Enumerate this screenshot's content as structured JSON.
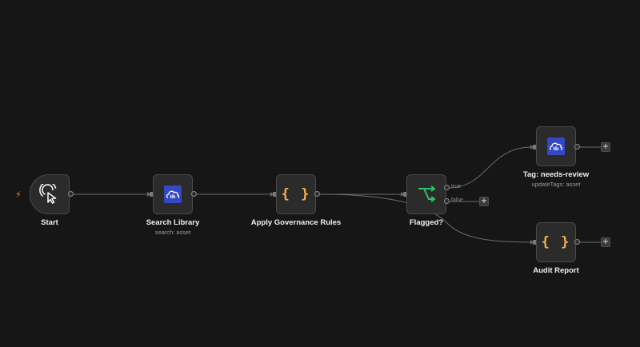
{
  "nodes": {
    "start": {
      "label": "Start",
      "icon": "cursor-click-icon"
    },
    "search_library": {
      "label": "Search Library",
      "sublabel": "search: asset",
      "icon": "cloudinary-icon"
    },
    "apply_rules": {
      "label": "Apply Governance Rules",
      "icon": "code-braces-icon",
      "icon_text": "{ }"
    },
    "flagged": {
      "label": "Flagged?",
      "icon": "branch-if-icon",
      "branches": {
        "true_label": "true",
        "false_label": "false"
      }
    },
    "tag_review": {
      "label": "Tag: needs-review",
      "sublabel": "updateTags: asset",
      "icon": "cloudinary-icon"
    },
    "audit_report": {
      "label": "Audit Report",
      "icon": "code-braces-icon",
      "icon_text": "{ }"
    }
  },
  "controls": {
    "add_symbol": "+",
    "trigger_symbol": "⚡"
  },
  "colors": {
    "background": "#161616",
    "node_bg": "#2b2b2b",
    "node_border": "#4a4a4a",
    "edge": "#6b6b6b",
    "code_icon": "#f6b24a",
    "branch_icon": "#2ec26a",
    "cloudinary": "#3448c5",
    "trigger_bolt": "#f08a24"
  }
}
